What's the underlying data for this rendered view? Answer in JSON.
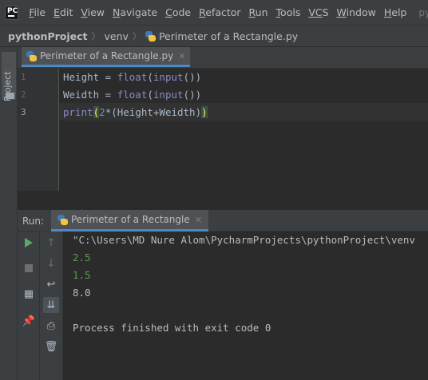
{
  "menu": {
    "logo": "PC",
    "items": [
      {
        "m": "F",
        "rest": "ile"
      },
      {
        "m": "E",
        "rest": "dit"
      },
      {
        "m": "V",
        "rest": "iew"
      },
      {
        "m": "N",
        "rest": "avigate"
      },
      {
        "m": "C",
        "rest": "ode"
      },
      {
        "m": "R",
        "rest": "efactor"
      },
      {
        "m": "R",
        "rest": "un"
      },
      {
        "m": "T",
        "rest": "ools"
      },
      {
        "m": "VC",
        "rest": "S"
      },
      {
        "m": "W",
        "rest": "indow"
      },
      {
        "m": "H",
        "rest": "elp"
      }
    ],
    "title_fragment": "pytho"
  },
  "breadcrumb": {
    "project": "pythonProject",
    "folder": "venv",
    "file": "Perimeter of a Rectangle.py"
  },
  "left_strip": {
    "project_label": "Project"
  },
  "editor": {
    "tab_label": "Perimeter of a Rectangle.py",
    "line_numbers": [
      "1",
      "2",
      "3"
    ],
    "lines": [
      {
        "var": "Height",
        "op": " = ",
        "fn": "float",
        "p1": "(",
        "fn2": "input",
        "p2": "())"
      },
      {
        "var": "Weidth",
        "op": " = ",
        "fn": "float",
        "p1": "(",
        "fn2": "input",
        "p2": "())"
      },
      {
        "fn": "print",
        "open": "(",
        "num": "2",
        "mid": "*(Height+Weidth)",
        "close": ")"
      }
    ]
  },
  "run": {
    "label": "Run:",
    "tab_label": "Perimeter of a Rectangle",
    "console": {
      "command": "\"C:\\Users\\MD Nure Alom\\PycharmProjects\\pythonProject\\venv",
      "input1": "2.5",
      "input2": "1.5",
      "output": "8.0",
      "exit": "Process finished with exit code 0"
    }
  },
  "colors": {
    "keyword": "#8888c6",
    "number": "#6897bb",
    "input_text": "#629755",
    "run_green": "#59a869"
  }
}
